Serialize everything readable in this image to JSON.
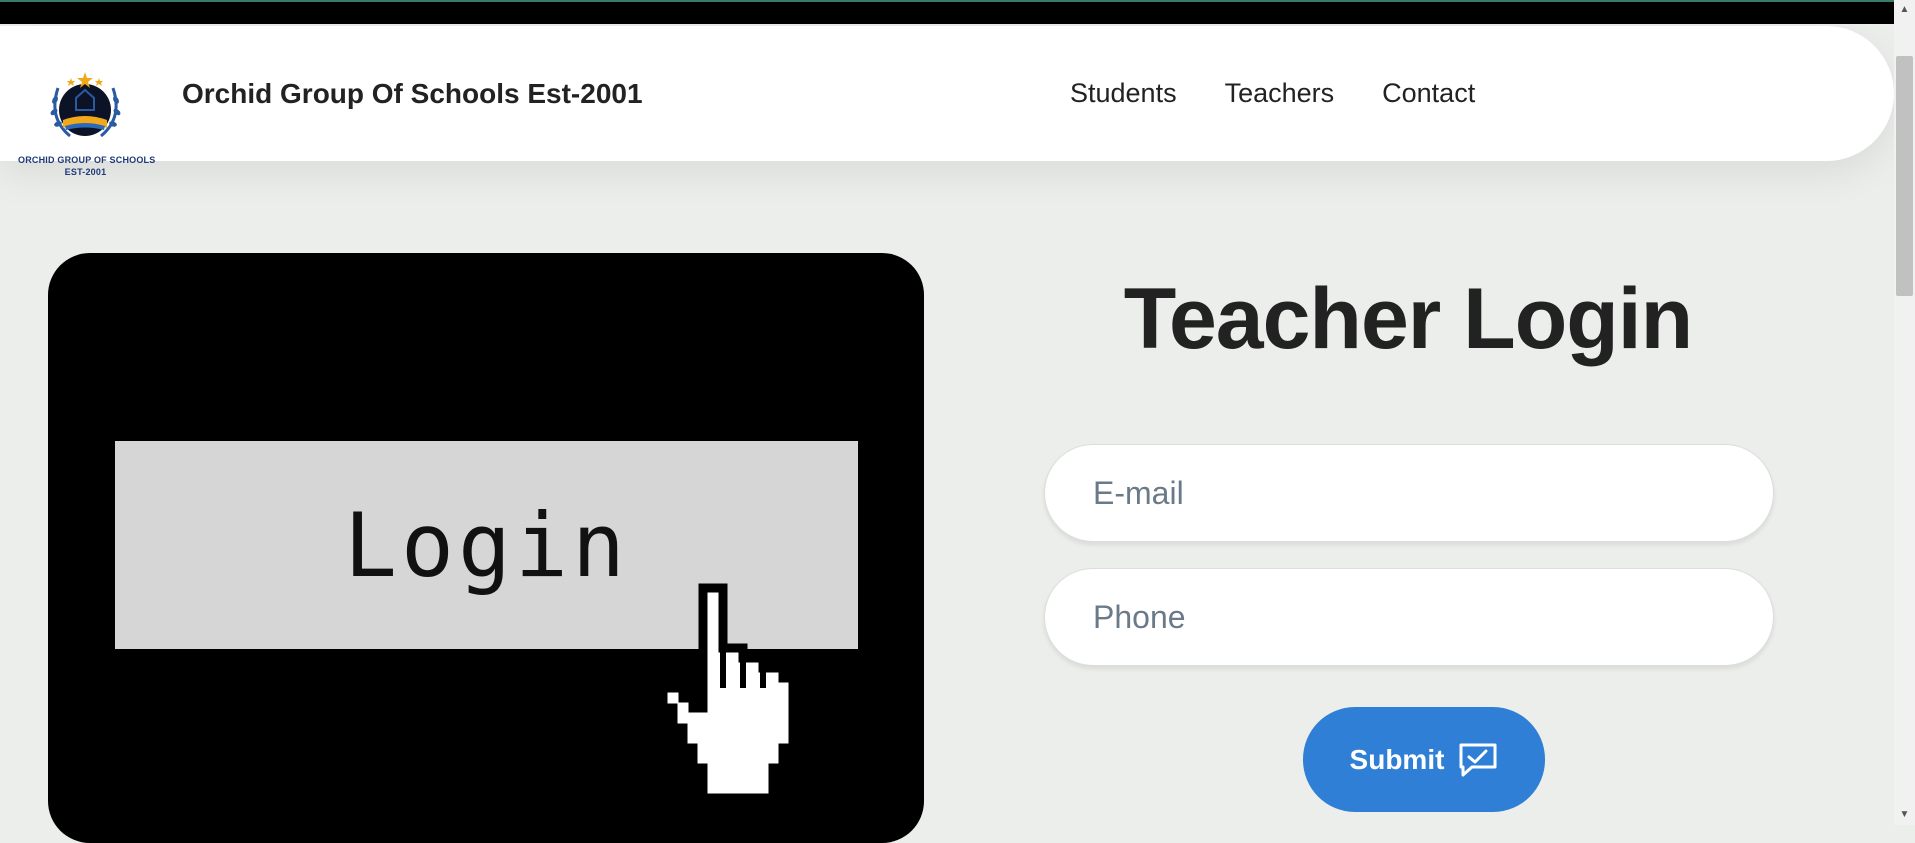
{
  "brand": {
    "name": "Orchid Group Of Schools Est-2001",
    "logo_text_line1": "ORCHID GROUP OF SCHOOLS",
    "logo_text_line2": "EST-2001"
  },
  "nav": {
    "items": [
      {
        "label": "Students"
      },
      {
        "label": "Teachers"
      },
      {
        "label": "Contact"
      }
    ]
  },
  "hero": {
    "button_text": "Login",
    "cursor_icon": "hand-pointer-icon"
  },
  "form": {
    "title": "Teacher Login",
    "email_placeholder": "E-mail",
    "email_value": "",
    "phone_placeholder": "Phone",
    "phone_value": "",
    "submit_label": "Submit",
    "submit_icon": "chat-check-icon"
  },
  "colors": {
    "accent": "#2f7fd6",
    "background": "#eceeeb",
    "hero_background": "#000000",
    "hero_button": "#d6d6d6"
  }
}
